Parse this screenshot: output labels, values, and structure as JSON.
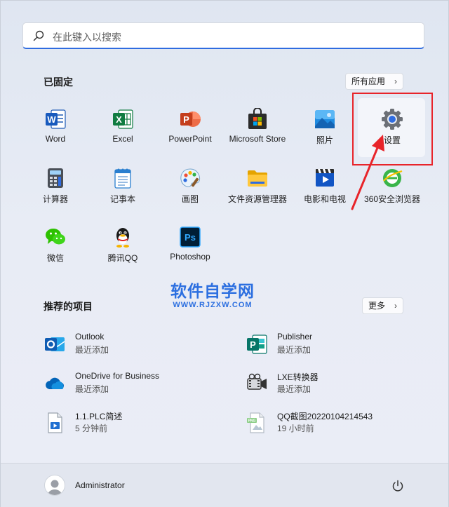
{
  "search": {
    "placeholder": "在此键入以搜索"
  },
  "pinned": {
    "title": "已固定",
    "all_apps_label": "所有应用",
    "apps": [
      {
        "label": "Word",
        "icon": "word-icon"
      },
      {
        "label": "Excel",
        "icon": "excel-icon"
      },
      {
        "label": "PowerPoint",
        "icon": "powerpoint-icon"
      },
      {
        "label": "Microsoft Store",
        "icon": "store-icon"
      },
      {
        "label": "照片",
        "icon": "photos-icon"
      },
      {
        "label": "设置",
        "icon": "gear-icon"
      },
      {
        "label": "计算器",
        "icon": "calculator-icon"
      },
      {
        "label": "记事本",
        "icon": "notepad-icon"
      },
      {
        "label": "画图",
        "icon": "paint-icon"
      },
      {
        "label": "文件资源管理器",
        "icon": "folder-icon"
      },
      {
        "label": "电影和电视",
        "icon": "movies-icon"
      },
      {
        "label": "360安全浏览器",
        "icon": "browser-360-icon"
      },
      {
        "label": "微信",
        "icon": "wechat-icon"
      },
      {
        "label": "腾讯QQ",
        "icon": "qq-icon"
      },
      {
        "label": "Photoshop",
        "icon": "photoshop-icon"
      }
    ]
  },
  "recommended": {
    "title": "推荐的项目",
    "more_label": "更多",
    "items": [
      {
        "name": "Outlook",
        "sub": "最近添加",
        "icon": "outlook-icon"
      },
      {
        "name": "Publisher",
        "sub": "最近添加",
        "icon": "publisher-icon"
      },
      {
        "name": "OneDrive for Business",
        "sub": "最近添加",
        "icon": "onedrive-icon"
      },
      {
        "name": "LXE转换器",
        "sub": "最近添加",
        "icon": "lxe-converter-icon"
      },
      {
        "name": "1.1.PLC简述",
        "sub": "5 分钟前",
        "icon": "video-file-icon"
      },
      {
        "name": "QQ截图20220104214543",
        "sub": "19 小时前",
        "icon": "png-file-icon"
      }
    ]
  },
  "watermark": {
    "title": "软件自学网",
    "url": "WWW.RJZXW.COM"
  },
  "footer": {
    "user": "Administrator"
  },
  "colors": {
    "accent": "#2f6ce0",
    "annotation": "#e8242a"
  }
}
